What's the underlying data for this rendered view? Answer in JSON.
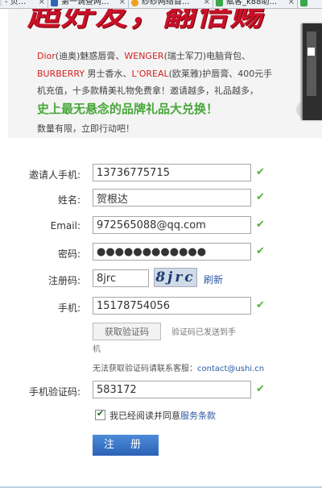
{
  "browser": {
    "tabs": [
      {
        "label": "- 贝...",
        "icon_color": "#d9d9d9"
      },
      {
        "label": "第一调查网...",
        "icon_color": "#2c67b5"
      },
      {
        "label": "纱纱网络首...",
        "icon_color": "#f0a020"
      },
      {
        "label": "赋客_k88助...",
        "icon_color": "#3aa84a"
      },
      {
        "label": "",
        "icon_color": "#3aa84a"
      }
    ],
    "tab_close": "×"
  },
  "banner": {
    "slogan": "超好友，翻倍赐",
    "line1_dior": "Dior",
    "line1_a": "(迪奥)魅惑唇膏、",
    "line1_wenger": "WENGER",
    "line1_b": "(瑞士军刀)电脑背包、",
    "line2_burberry": "BURBERRY",
    "line2_a": " 男士香水、",
    "line2_loreal": "L'OREAL",
    "line2_b": "(欧莱雅)护唇膏、400元手",
    "line3": "机充值，十多款精美礼物免费拿！邀请越多，礼品越多，",
    "highlight": "史上最无悬念的品牌礼品大兑换！",
    "limited": "数量有限，立即行动吧！"
  },
  "form": {
    "inviter_label": "邀请人手机:",
    "inviter_value": "13736775715",
    "name_label": "姓名:",
    "name_value": "贺根达",
    "email_label": "Email:",
    "email_value": "972565088@qq.com",
    "password_label": "密码:",
    "password_value": "●●●●●●●●●●●●",
    "captcha_label": "注册码:",
    "captcha_value": "8jrc",
    "captcha_image_text": "8jrc",
    "refresh_label": "刷新",
    "phone_label": "手机:",
    "phone_value": "15178754056",
    "get_code_button": "获取验证码",
    "code_sent_note": "验证码已发送到手",
    "code_sent_note2": "机",
    "help_text": "无法获取验证码请联系客服：",
    "help_email": "contact@ushi.cn",
    "sms_code_label": "手机验证码:",
    "sms_code_value": "583172",
    "agree_text": "我已经阅读并同意",
    "terms_link": "服务条款",
    "submit_label": "注 册",
    "check_mark": "✔"
  },
  "colors": {
    "accent_blue": "#2c62b8",
    "check_green": "#53b33b",
    "brand_red": "#c8112a"
  }
}
